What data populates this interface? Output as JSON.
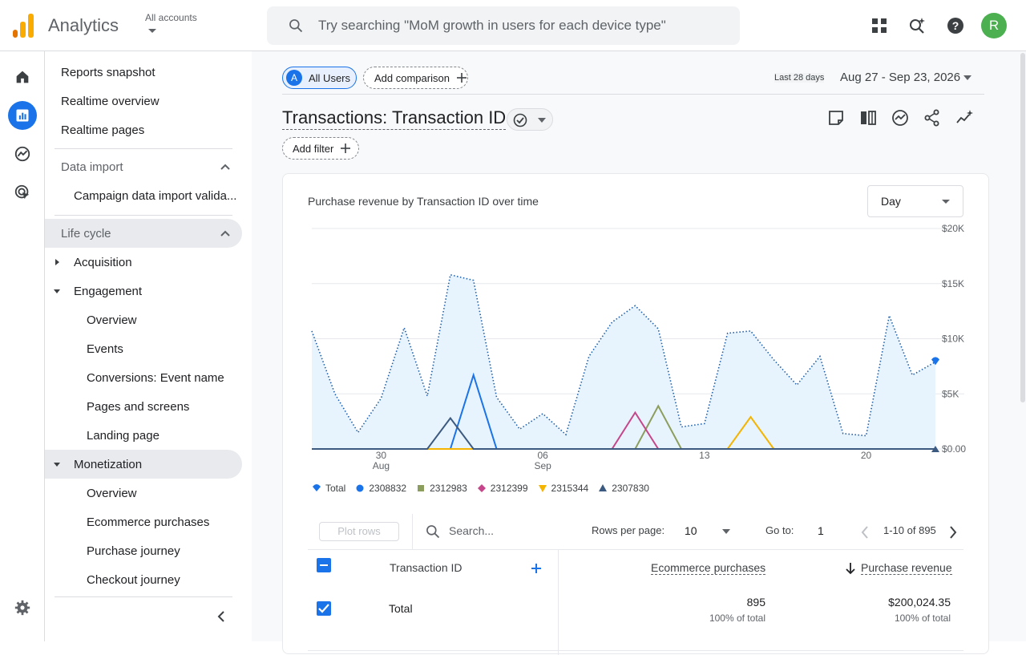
{
  "app": {
    "title": "Analytics",
    "accounts_label": "All accounts",
    "avatar_initial": "R"
  },
  "search": {
    "placeholder": "Try searching \"MoM growth in users for each device type\""
  },
  "nav": {
    "items": [
      {
        "label": "Reports snapshot"
      },
      {
        "label": "Realtime overview"
      },
      {
        "label": "Realtime pages"
      }
    ],
    "data_import": {
      "label": "Data import",
      "items": [
        {
          "label": "Campaign data import valida..."
        }
      ]
    },
    "life_cycle": {
      "label": "Life cycle",
      "acquisition": "Acquisition",
      "engagement": {
        "label": "Engagement",
        "items": [
          {
            "label": "Overview"
          },
          {
            "label": "Events"
          },
          {
            "label": "Conversions: Event name"
          },
          {
            "label": "Pages and screens"
          },
          {
            "label": "Landing page"
          }
        ]
      },
      "monetization": {
        "label": "Monetization",
        "items": [
          {
            "label": "Overview"
          },
          {
            "label": "Ecommerce purchases"
          },
          {
            "label": "Purchase journey"
          },
          {
            "label": "Checkout journey"
          }
        ]
      }
    }
  },
  "comparison": {
    "all_users_badge": "A",
    "all_users": "All Users",
    "add_comparison": "Add comparison"
  },
  "date": {
    "badge": "Last 28 days",
    "range": "Aug 27 - Sep 23, 2026"
  },
  "report": {
    "title": "Transactions: Transaction ID",
    "add_filter": "Add filter"
  },
  "chart": {
    "title": "Purchase revenue by Transaction ID over time",
    "granularity": "Day"
  },
  "chart_data": {
    "type": "area",
    "title": "Purchase revenue by Transaction ID over time",
    "x": [
      "Aug 27",
      "Aug 28",
      "Aug 29",
      "Aug 30",
      "Aug 31",
      "Sep 1",
      "Sep 2",
      "Sep 3",
      "Sep 4",
      "Sep 5",
      "Sep 6",
      "Sep 7",
      "Sep 8",
      "Sep 9",
      "Sep 10",
      "Sep 11",
      "Sep 12",
      "Sep 13",
      "Sep 14",
      "Sep 15",
      "Sep 16",
      "Sep 17",
      "Sep 18",
      "Sep 19",
      "Sep 20",
      "Sep 21",
      "Sep 22",
      "Sep 23"
    ],
    "x_tick_labels": [
      {
        "day": "30",
        "month": "Aug"
      },
      {
        "day": "06",
        "month": "Sep"
      },
      {
        "day": "13",
        "month": ""
      },
      {
        "day": "20",
        "month": ""
      }
    ],
    "y_tick_labels": [
      "$20K",
      "$15K",
      "$10K",
      "$5K",
      "$0.00"
    ],
    "ylim": [
      0,
      20000
    ],
    "series": [
      {
        "name": "Total",
        "color": "#1a73e8",
        "values": [
          10700,
          5000,
          1500,
          4600,
          11000,
          4800,
          15800,
          15300,
          4700,
          1800,
          3200,
          1300,
          8400,
          11500,
          13000,
          10900,
          2000,
          2300,
          10500,
          10700,
          8100,
          5800,
          8400,
          1400,
          1200,
          12100,
          6700,
          7900
        ]
      },
      {
        "name": "2308832",
        "color": "#1a73e8",
        "values": [
          0,
          0,
          0,
          0,
          0,
          0,
          0,
          6700,
          0,
          0,
          0,
          0,
          0,
          0,
          0,
          0,
          0,
          0,
          0,
          0,
          0,
          0,
          0,
          0,
          0,
          0,
          0,
          0
        ]
      },
      {
        "name": "2312983",
        "color": "#8c9e5e",
        "values": [
          0,
          0,
          0,
          0,
          0,
          0,
          0,
          0,
          0,
          0,
          0,
          0,
          0,
          0,
          0,
          3900,
          0,
          0,
          0,
          0,
          0,
          0,
          0,
          0,
          0,
          0,
          0,
          0
        ]
      },
      {
        "name": "2312399",
        "color": "#c5468a",
        "values": [
          0,
          0,
          0,
          0,
          0,
          0,
          0,
          0,
          0,
          0,
          0,
          0,
          0,
          0,
          3300,
          0,
          0,
          0,
          0,
          0,
          0,
          0,
          0,
          0,
          0,
          0,
          0,
          0
        ]
      },
      {
        "name": "2315344",
        "color": "#f4b400",
        "values": [
          0,
          0,
          0,
          0,
          0,
          0,
          0,
          0,
          0,
          0,
          0,
          0,
          0,
          0,
          0,
          0,
          0,
          0,
          0,
          2900,
          0,
          0,
          0,
          0,
          0,
          0,
          0,
          0
        ]
      },
      {
        "name": "2307830",
        "color": "#3c5a80",
        "values": [
          0,
          0,
          0,
          0,
          0,
          0,
          2800,
          0,
          0,
          0,
          0,
          0,
          0,
          0,
          0,
          0,
          0,
          0,
          0,
          0,
          0,
          0,
          0,
          0,
          0,
          0,
          0,
          0
        ]
      }
    ],
    "grid": true,
    "legend_placement": "bottom-left"
  },
  "table": {
    "plot_rows": "Plot rows",
    "search_placeholder": "Search...",
    "rows_per_page_label": "Rows per page:",
    "rows_per_page": "10",
    "goto_label": "Go to:",
    "goto_value": "1",
    "pager": "1-10 of 895",
    "headers": {
      "dimension": "Transaction ID",
      "m1": "Ecommerce purchases",
      "m2": "Purchase revenue"
    },
    "total": {
      "label": "Total",
      "m1": "895",
      "m1_sub": "100% of total",
      "m2": "$200,024.35",
      "m2_sub": "100% of total"
    }
  }
}
